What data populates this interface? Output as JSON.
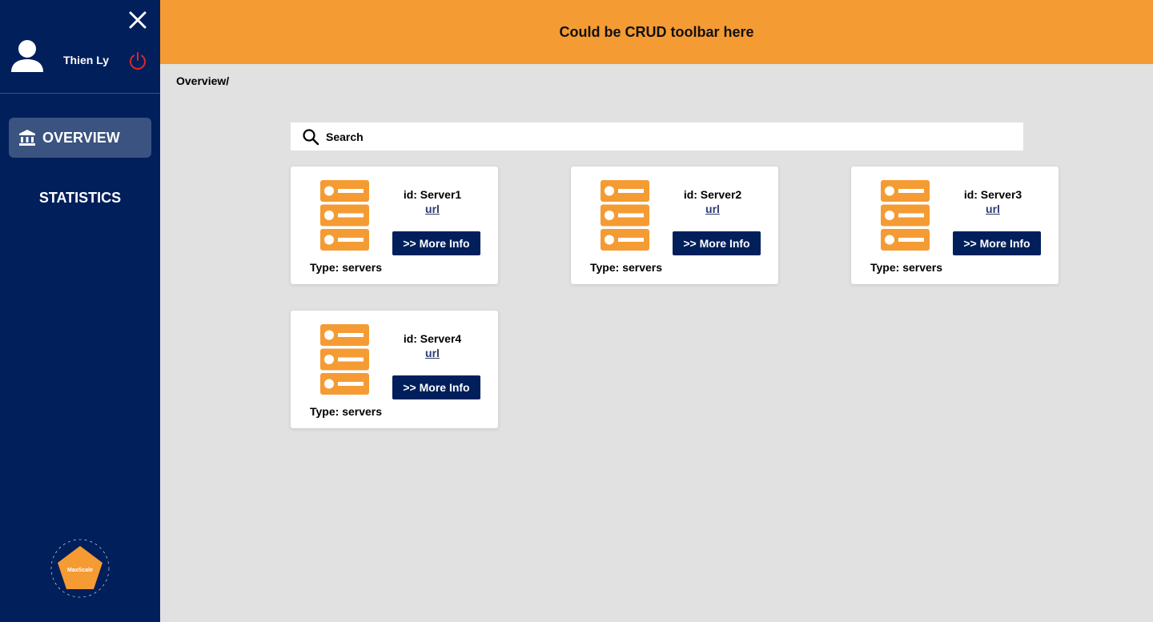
{
  "sidebar": {
    "user_name": "Thien Ly",
    "nav": [
      {
        "label": "OVERVIEW",
        "active": true
      },
      {
        "label": "STATISTICS",
        "active": false
      }
    ],
    "logo_text": "MaxScale"
  },
  "topbar": {
    "title": "Could be CRUD toolbar here"
  },
  "breadcrumb": "Overview/",
  "search": {
    "placeholder": "Search",
    "value": ""
  },
  "cards": [
    {
      "id": "id: Server1",
      "url": "url",
      "button": ">> More Info",
      "type": "Type: servers"
    },
    {
      "id": "id: Server2",
      "url": "url",
      "button": ">> More Info",
      "type": "Type: servers"
    },
    {
      "id": "id: Server3",
      "url": "url",
      "button": ">> More Info",
      "type": "Type: servers"
    },
    {
      "id": "id: Server4",
      "url": "url",
      "button": ">> More Info",
      "type": "Type: servers"
    }
  ],
  "colors": {
    "sidebar": "#001f5b",
    "accent": "#f59b33",
    "background": "#e1e1e1",
    "power": "#e0262b"
  }
}
